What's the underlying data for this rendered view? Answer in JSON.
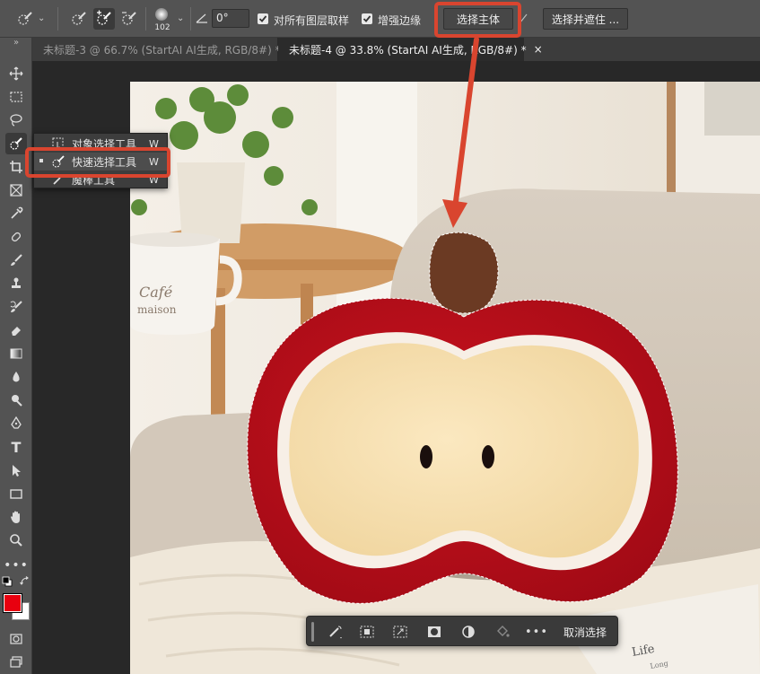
{
  "options_bar": {
    "brush_size": "102",
    "angle_value": "0°",
    "sample_all_layers_label": "对所有图层取样",
    "enhance_edge_label": "增强边缘",
    "select_subject_label": "选择主体",
    "select_and_mask_label": "选择并遮住 ..."
  },
  "tabs": [
    {
      "label": "未标题-3 @ 66.7% (StartAI AI生成, RGB/8#) *",
      "close": "×"
    },
    {
      "label": "未标题-4 @ 33.8% (StartAI AI生成, RGB/8#) *",
      "close": "×"
    }
  ],
  "toolbar": {
    "items": [
      "move-icon",
      "marquee-icon",
      "lasso-icon",
      "quick-selection-icon",
      "crop-icon",
      "frame-icon",
      "eyedropper-icon",
      "spot-healing-icon",
      "brush-icon",
      "stamp-icon",
      "history-brush-icon",
      "eraser-icon",
      "gradient-icon",
      "blur-icon",
      "dodge-icon",
      "pen-icon",
      "type-icon",
      "path-selection-icon",
      "rectangle-icon",
      "hand-icon",
      "zoom-icon",
      "more-icon"
    ],
    "foreground_color": "#e8000f",
    "background_color": "#ffffff"
  },
  "flyout": {
    "items": [
      {
        "label": "对象选择工具",
        "shortcut": "W"
      },
      {
        "label": "快速选择工具",
        "shortcut": "W"
      },
      {
        "label": "魔棒工具",
        "shortcut": "W"
      }
    ]
  },
  "taskbar": {
    "deselect_label": "取消选择"
  },
  "photo": {
    "mug_text_line1": "Café",
    "mug_text_line2": "maison",
    "book_text": "Life",
    "book_text2": "Long"
  },
  "colors": {
    "highlight": "#d9452f",
    "panel": "#535353",
    "canvas_bg": "#282828"
  }
}
